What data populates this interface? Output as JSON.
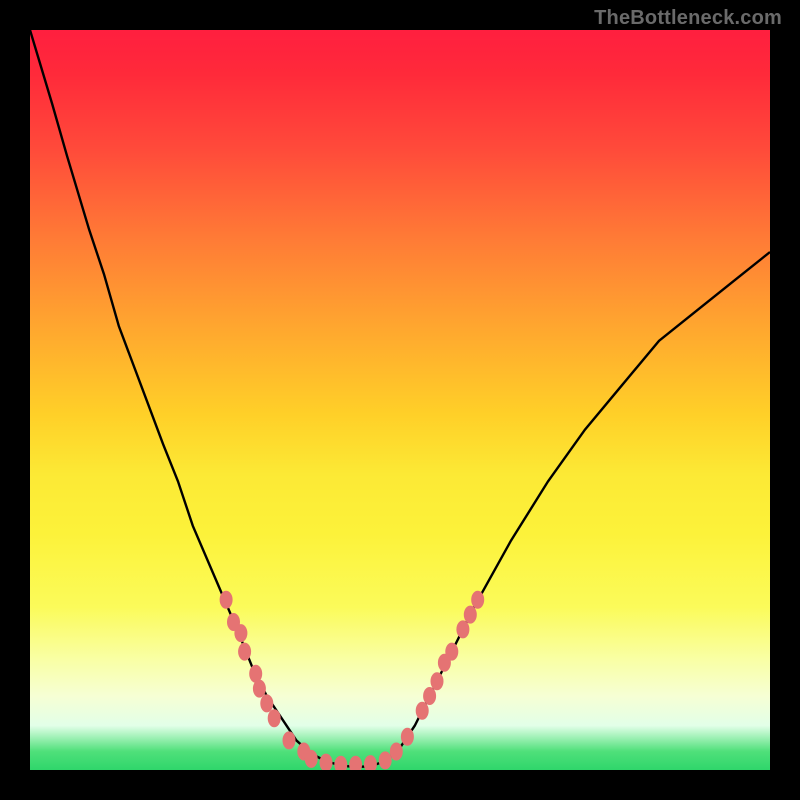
{
  "watermark": "TheBottleneck.com",
  "colors": {
    "background": "#000000",
    "gradient_top": "#ff1f3f",
    "gradient_mid": "#ffd028",
    "gradient_bottom": "#2fd66b",
    "curve_stroke": "#000000",
    "marker_fill": "#e57373",
    "marker_stroke": "#c75656"
  },
  "chart_data": {
    "type": "line",
    "title": "",
    "xlabel": "",
    "ylabel": "",
    "xlim": [
      0,
      100
    ],
    "ylim": [
      0,
      100
    ],
    "axes_visible": false,
    "legend": false,
    "annotations": [],
    "series": [
      {
        "name": "curve",
        "x": [
          0,
          3,
          5,
          8,
          10,
          12,
          15,
          18,
          20,
          22,
          25,
          28,
          30,
          32,
          34,
          36,
          38,
          40,
          42,
          44,
          46,
          48,
          50,
          52,
          54,
          56,
          60,
          65,
          70,
          75,
          80,
          85,
          90,
          95,
          100
        ],
        "y": [
          100,
          90,
          83,
          73,
          67,
          60,
          52,
          44,
          39,
          33,
          26,
          19,
          14,
          10,
          7,
          4,
          2.2,
          1.2,
          0.6,
          0.4,
          0.5,
          1.2,
          3,
          6,
          10,
          14,
          22,
          31,
          39,
          46,
          52,
          58,
          62,
          66,
          70
        ]
      }
    ],
    "markers": [
      {
        "x": 26.5,
        "y": 23
      },
      {
        "x": 27.5,
        "y": 20
      },
      {
        "x": 28.5,
        "y": 18.5
      },
      {
        "x": 29,
        "y": 16
      },
      {
        "x": 30.5,
        "y": 13
      },
      {
        "x": 31,
        "y": 11
      },
      {
        "x": 32,
        "y": 9
      },
      {
        "x": 33,
        "y": 7
      },
      {
        "x": 35,
        "y": 4
      },
      {
        "x": 37,
        "y": 2.5
      },
      {
        "x": 38,
        "y": 1.5
      },
      {
        "x": 40,
        "y": 1
      },
      {
        "x": 42,
        "y": 0.7
      },
      {
        "x": 44,
        "y": 0.7
      },
      {
        "x": 46,
        "y": 0.8
      },
      {
        "x": 48,
        "y": 1.3
      },
      {
        "x": 49.5,
        "y": 2.5
      },
      {
        "x": 51,
        "y": 4.5
      },
      {
        "x": 53,
        "y": 8
      },
      {
        "x": 54,
        "y": 10
      },
      {
        "x": 55,
        "y": 12
      },
      {
        "x": 56,
        "y": 14.5
      },
      {
        "x": 57,
        "y": 16
      },
      {
        "x": 58.5,
        "y": 19
      },
      {
        "x": 59.5,
        "y": 21
      },
      {
        "x": 60.5,
        "y": 23
      }
    ]
  }
}
